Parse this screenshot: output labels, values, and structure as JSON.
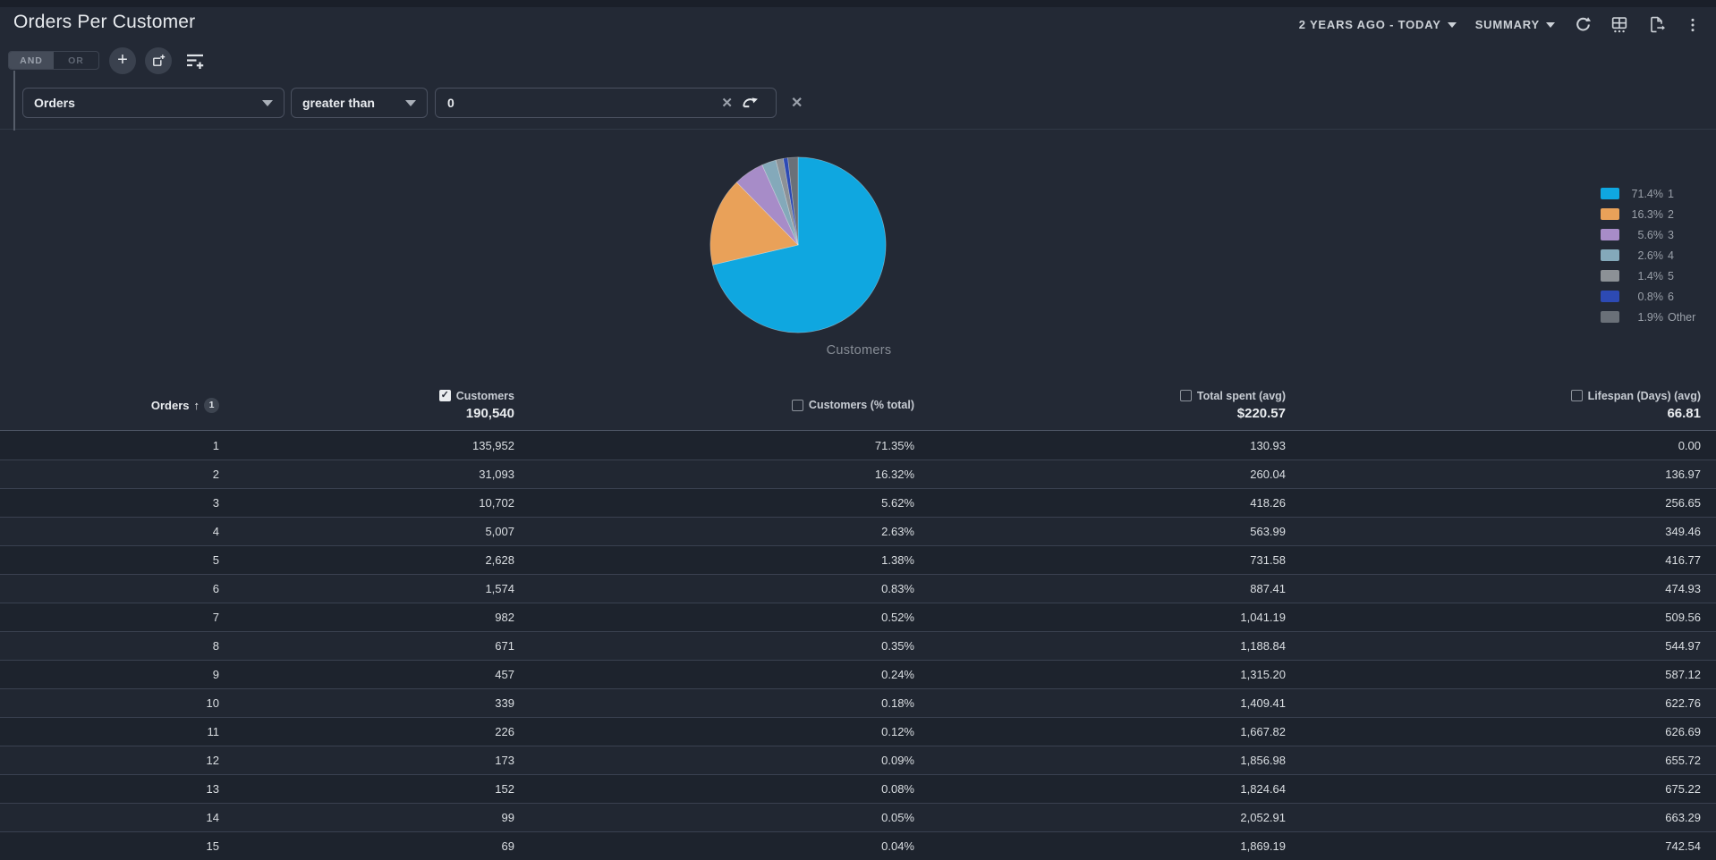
{
  "header": {
    "title": "Orders Per Customer",
    "date_range": "2 YEARS AGO - TODAY",
    "view_mode": "SUMMARY",
    "icons": [
      "refresh-icon",
      "table-grid-icon",
      "export-icon",
      "kebab-menu-icon"
    ]
  },
  "filter": {
    "and_label": "AND",
    "or_label": "OR",
    "selected_logic": "AND",
    "field": "Orders",
    "operator": "greater than",
    "value": "0",
    "icons": [
      "add-filter-icon",
      "add-group-icon",
      "filter-list-add-icon",
      "clear-input-icon",
      "redo-icon",
      "remove-filter-icon"
    ]
  },
  "chart_data": {
    "type": "pie",
    "title": "Customers",
    "legend_position": "right",
    "slices": [
      {
        "label": "1",
        "pct_display": "71.4%",
        "value": 71.35,
        "color": "#0fa7e0"
      },
      {
        "label": "2",
        "pct_display": "16.3%",
        "value": 16.32,
        "color": "#e9a159"
      },
      {
        "label": "3",
        "pct_display": "5.6%",
        "value": 5.62,
        "color": "#a78cc8"
      },
      {
        "label": "4",
        "pct_display": "2.6%",
        "value": 2.63,
        "color": "#84a9ba"
      },
      {
        "label": "5",
        "pct_display": "1.4%",
        "value": 1.38,
        "color": "#8c9196"
      },
      {
        "label": "6",
        "pct_display": "0.8%",
        "value": 0.83,
        "color": "#2d4ab4"
      },
      {
        "label": "Other",
        "pct_display": "1.9%",
        "value": 1.87,
        "color": "#6a7078"
      }
    ]
  },
  "table": {
    "columns": [
      {
        "label": "Orders",
        "sort": "asc",
        "sort_index": "1",
        "checked": null,
        "total": ""
      },
      {
        "label": "Customers",
        "checked": true,
        "total": "190,540"
      },
      {
        "label": "Customers (% total)",
        "checked": false,
        "total": ""
      },
      {
        "label": "Total spent (avg)",
        "checked": false,
        "total": "$220.57"
      },
      {
        "label": "Lifespan (Days) (avg)",
        "checked": false,
        "total": "66.81"
      }
    ],
    "rows": [
      [
        "1",
        "135,952",
        "71.35%",
        "130.93",
        "0.00"
      ],
      [
        "2",
        "31,093",
        "16.32%",
        "260.04",
        "136.97"
      ],
      [
        "3",
        "10,702",
        "5.62%",
        "418.26",
        "256.65"
      ],
      [
        "4",
        "5,007",
        "2.63%",
        "563.99",
        "349.46"
      ],
      [
        "5",
        "2,628",
        "1.38%",
        "731.58",
        "416.77"
      ],
      [
        "6",
        "1,574",
        "0.83%",
        "887.41",
        "474.93"
      ],
      [
        "7",
        "982",
        "0.52%",
        "1,041.19",
        "509.56"
      ],
      [
        "8",
        "671",
        "0.35%",
        "1,188.84",
        "544.97"
      ],
      [
        "9",
        "457",
        "0.24%",
        "1,315.20",
        "587.12"
      ],
      [
        "10",
        "339",
        "0.18%",
        "1,409.41",
        "622.76"
      ],
      [
        "11",
        "226",
        "0.12%",
        "1,667.82",
        "626.69"
      ],
      [
        "12",
        "173",
        "0.09%",
        "1,856.98",
        "655.72"
      ],
      [
        "13",
        "152",
        "0.08%",
        "1,824.64",
        "675.22"
      ],
      [
        "14",
        "99",
        "0.05%",
        "2,052.91",
        "663.29"
      ],
      [
        "15",
        "69",
        "0.04%",
        "1,869.19",
        "742.54"
      ]
    ]
  },
  "colors": {
    "page_bg": "#232935",
    "top_strip": "#1a1f29",
    "row_separator": "#3a4150",
    "header_separator": "#4e5665",
    "accent_cyan": "#0fa7e0"
  }
}
